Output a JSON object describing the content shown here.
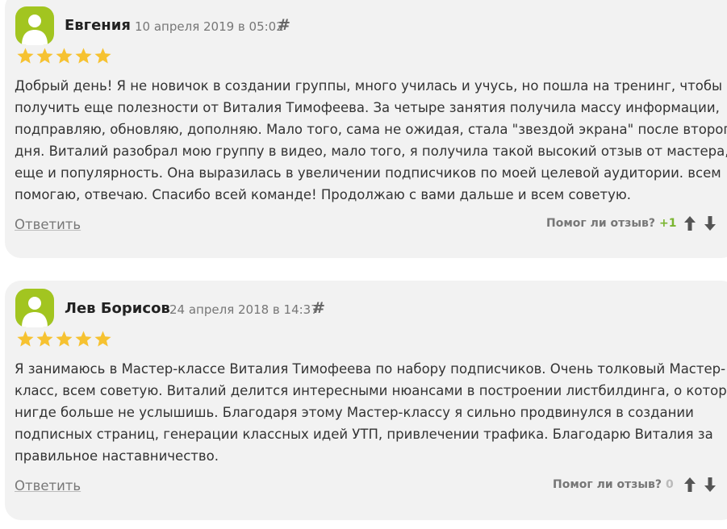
{
  "reviews": [
    {
      "author": "Евгения",
      "date": "10 апреля 2019 в 05:02",
      "hash": "#",
      "rating": 5,
      "lines": [
        "Добрый день! Я не новичок в создании группы, много училась и учусь, но пошла на тренинг, чтобы",
        "получить еще полезности от Виталия Тимофеева. За четыре занятия получила массу информации,",
        "подправляю, обновляю, дополняю. Мало того, сама не ожидая, стала \"звездой экрана\" после второго",
        "дня. Виталий разобрал мою группу в видео, мало того, я получила такой высокий отзыв от мастера, так",
        "еще и популярность. Она выразилась в увеличении подписчиков по моей целевой аудитории. всем",
        "помогаю, отвечаю. Спасибо всей команде! Продолжаю с вами дальше и всем советую."
      ],
      "reply_label": "Ответить",
      "helpful_label": "Помог ли отзыв?",
      "score": "+1"
    },
    {
      "author": "Лев Борисов",
      "date": "24 апреля 2018 в 14:37",
      "hash": "#",
      "rating": 5,
      "lines": [
        "Я занимаюсь в Мастер-классе Виталия Тимофеева по набору подписчиков. Очень толковый Мастер-",
        "класс, всем советую. Виталий делится интересными нюансами в построении листбилдинга, о которых",
        "нигде больше не услышишь. Благодаря этому Мастер-классу я сильно продвинулся в создании",
        "подписных страниц, генерации классных идей УТП, привлечении трафика. Благодарю Виталия за",
        "правильное наставничество."
      ],
      "reply_label": "Ответить",
      "helpful_label": "Помог ли отзыв?",
      "score": "0"
    }
  ],
  "colors": {
    "avatar": "#a2c520",
    "star": "#f6c231",
    "positive_score": "#7ab530",
    "card_bg": "#f2f2f2"
  },
  "icons": {
    "avatar": "user-silhouette-icon",
    "star": "star-icon",
    "vote_up": "arrow-up-icon",
    "vote_down": "arrow-down-icon"
  }
}
